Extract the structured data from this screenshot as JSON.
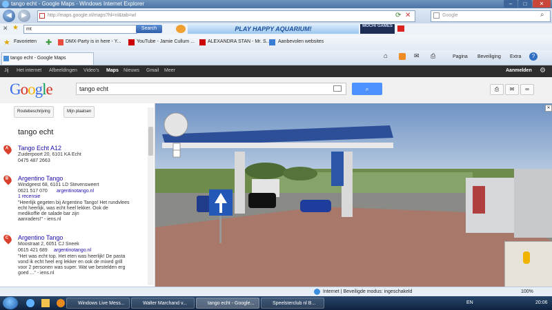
{
  "window": {
    "title": "tango echt - Google Maps - Windows Internet Explorer"
  },
  "addressbar": {
    "url": "http://maps.google.nl/maps?hl=nl&tab=wl",
    "search_placeholder": "Google"
  },
  "toolbar": {
    "input_value": "mt",
    "search_label": "Search",
    "banner": "PLAY HAPPY AQUARIUM!",
    "mochi": "MOCHI GAMES"
  },
  "favorites": {
    "label": "Favorieten",
    "items": [
      "DMX-Party is in here - Y...",
      "YouTube - Jamie Cullum ...",
      "ALEXANDRA STAN - Mr. S...",
      "Aanbevolen websites"
    ]
  },
  "tab": {
    "title": "tango echt - Google Maps"
  },
  "commands": {
    "page": "Pagina",
    "safety": "Beveiliging",
    "extra": "Extra"
  },
  "gbar": {
    "items": [
      "Jij",
      "Het internet",
      "Afbeeldingen",
      "Video's",
      "Maps",
      "Nieuws",
      "Gmail",
      "Meer"
    ],
    "signin": "Aanmelden"
  },
  "google": {
    "logo": "Google",
    "query": "tango echt"
  },
  "panel": {
    "route_btn": "Routebeschrijving",
    "places_btn": "Mijn plaatsen",
    "title": "tango echt",
    "results": [
      {
        "marker": "A",
        "title": "Tango Echt A12",
        "lines": [
          "Zuiderpoort 20, 6101 KA Echt",
          "0475 487 2663"
        ]
      },
      {
        "marker": "B",
        "title": "Argentino Tango",
        "lines": [
          "Windgeest 68, 6101 LD Stevensweert",
          "0621 517 070",
          "\"Heerlijk gegeten bij Argentino Tango! Het rundvlees",
          "echt heerlijk, was echt heel lekker. Ook de",
          "medikoffie de salade bar zijn",
          "aanraders!\" - iens.nl"
        ],
        "links": [
          "1 recensie",
          "argentinotango.nl"
        ]
      },
      {
        "marker": "C",
        "title": "Argentino Tango",
        "lines": [
          "Moostraat 2, 6051 CJ Sneek",
          "0615 421 689",
          "\"Het was echt top. Het eten was heerlijk! De pasta",
          "vond ik echt heel erg lekker en ook de mixed grill",
          "voor 2 personen was super. Wat we bestelden erg",
          "goed ...\" - iens.nl"
        ],
        "links": [
          "argentinotango.nl"
        ]
      }
    ]
  },
  "status": {
    "zone": "Internet | Beveiligde modus: ingeschakeld",
    "zoom": "100%"
  },
  "taskbar": {
    "items": [
      "Windows Live Mess...",
      "Walter Marchand v...",
      "tango echt - Google...",
      "Speelsterclub nl B..."
    ],
    "lang": "EN",
    "clock": "20:06"
  }
}
